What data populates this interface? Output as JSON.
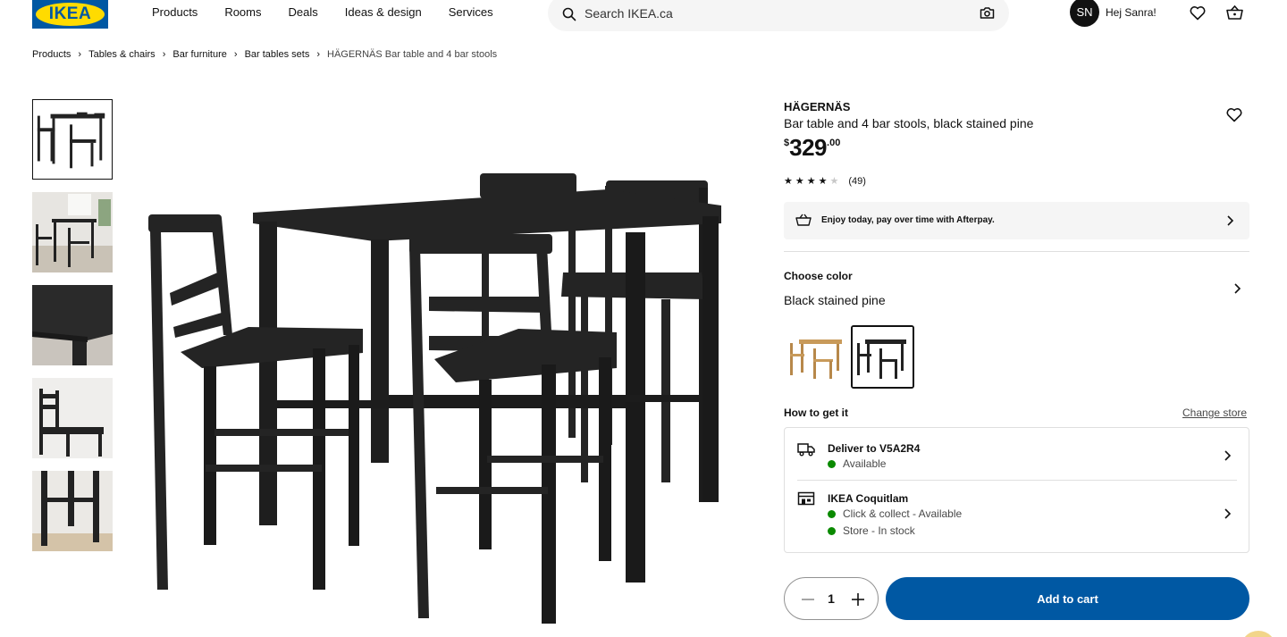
{
  "header": {
    "logo_text": "IKEA",
    "nav": [
      "Products",
      "Rooms",
      "Deals",
      "Ideas & design",
      "Services"
    ],
    "search_placeholder": "Search IKEA.ca",
    "avatar_initials": "SN",
    "greeting": "Hej Sanra!"
  },
  "breadcrumb": [
    "Products",
    "Tables & chairs",
    "Bar furniture",
    "Bar tables sets",
    "HÄGERNÄS Bar table and 4 bar stools"
  ],
  "product": {
    "name": "HÄGERNÄS",
    "description": "Bar table and 4 bar stools, black stained pine",
    "price_currency": "$",
    "price_integer": "329",
    "price_decimal": ".00",
    "rating_stars": 4,
    "rating_max": 5,
    "rating_count": "(49)"
  },
  "afterpay": {
    "text": "Enjoy today, pay over time with Afterpay."
  },
  "color": {
    "label": "Choose color",
    "value": "Black stained pine",
    "swatches": [
      "natural pine",
      "black stained pine"
    ]
  },
  "get_it": {
    "label": "How to get it",
    "change_store": "Change store",
    "delivery_title": "Deliver to V5A2R4",
    "delivery_status": "Available",
    "store_title": "IKEA Coquitlam",
    "store_click_collect": "Click & collect - Available",
    "store_stock": "Store - In stock"
  },
  "cart": {
    "quantity": "1",
    "add_label": "Add to cart"
  },
  "colors": {
    "ikea_blue": "#0058a3",
    "ikea_yellow": "#ffdb00",
    "available_green": "#0a8a00"
  }
}
